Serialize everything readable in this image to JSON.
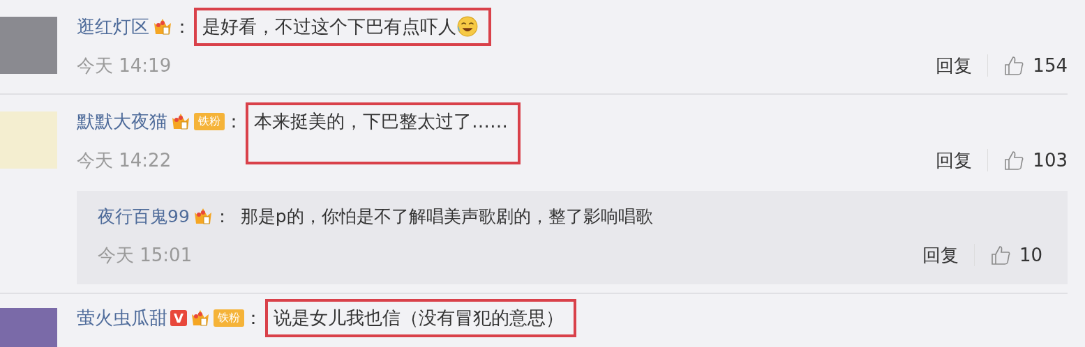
{
  "comments": [
    {
      "user": "逛红灯区",
      "badges": [
        {
          "kind": "crown"
        }
      ],
      "colon": "：",
      "text": "是好看，不过这个下巴有点吓人",
      "emoji": true,
      "highlighted": true,
      "time": "今天 14:19",
      "reply_label": "回复",
      "likes": "154"
    },
    {
      "user": "默默大夜猫",
      "badges": [
        {
          "kind": "crown"
        },
        {
          "kind": "fan",
          "label": "铁粉"
        }
      ],
      "colon": "：",
      "text": "本来挺美的，下巴整太过了……",
      "highlighted": true,
      "time": "今天 14:22",
      "reply_label": "回复",
      "likes": "103",
      "replies": [
        {
          "user": "夜行百鬼99",
          "badges": [
            {
              "kind": "crown"
            }
          ],
          "colon": "：",
          "text": "那是p的，你怕是不了解唱美声歌剧的，整了影响唱歌",
          "time": "今天 15:01",
          "reply_label": "回复",
          "likes": "10"
        }
      ]
    },
    {
      "user": "萤火虫瓜甜",
      "badges": [
        {
          "kind": "vip",
          "label": "V"
        },
        {
          "kind": "crown"
        },
        {
          "kind": "fan",
          "label": "铁粉"
        }
      ],
      "colon": "：",
      "text": "说是女儿我也信（没有冒犯的意思）",
      "highlighted": true
    }
  ]
}
